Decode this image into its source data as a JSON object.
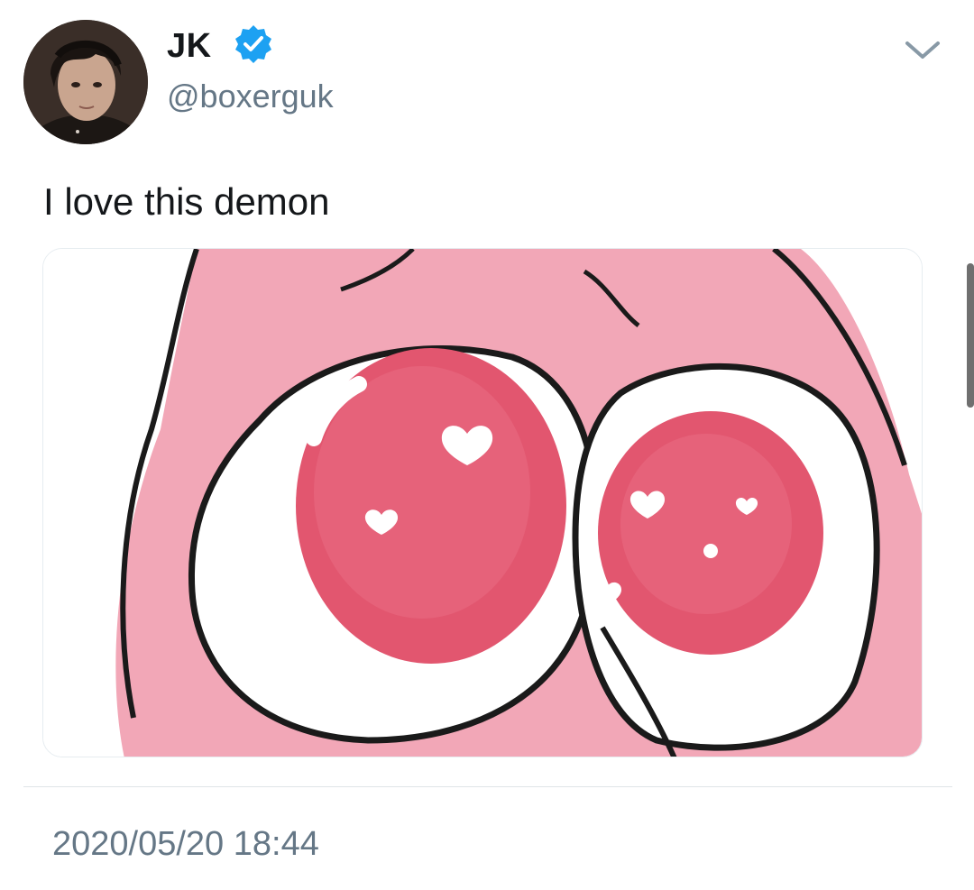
{
  "tweet": {
    "author": {
      "display_name": "JK",
      "handle": "@boxerguk",
      "verified": true,
      "avatar_icon": "user-avatar"
    },
    "text": "I love this demon",
    "media": {
      "type": "image",
      "icon": "cartoon-heart-eyes"
    },
    "timestamp": "2020/05/20 18:44"
  },
  "icons": {
    "verified": "verified-badge-icon",
    "menu": "chevron-down-icon"
  },
  "colors": {
    "verified_blue": "#1da1f2",
    "text_primary": "#14171a",
    "text_secondary": "#657786",
    "pink_skin": "#f2a7b7",
    "eye_pink": "#e2566f"
  }
}
